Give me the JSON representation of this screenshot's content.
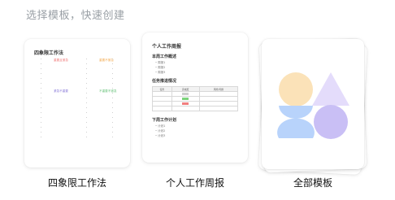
{
  "header": {
    "title": "选择模板，快速创建"
  },
  "cards": [
    {
      "label": "四象限工作法",
      "preview": {
        "title": "四象限工作法",
        "quadrants": [
          {
            "text": "重要且紧急",
            "color": "#f07878"
          },
          {
            "text": "重要不紧急",
            "color": "#f2a94e"
          },
          {
            "text": "紧急不重要",
            "color": "#8a7bd8"
          },
          {
            "text": "不重要不紧急",
            "color": "#67c27a"
          }
        ]
      }
    },
    {
      "label": "个人工作周报",
      "preview": {
        "title": "个人工作周报",
        "section1": "本周工作概述",
        "section1_items": [
          "周报1",
          "周报2",
          "周报3"
        ],
        "section2": "任务推进情况",
        "table_headers": [
          "任务",
          "完成度",
          "风险/问题"
        ],
        "section3": "下周工作计划",
        "section3_items": [
          "计划1",
          "计划2",
          "计划3"
        ]
      }
    },
    {
      "label": "全部模板",
      "preview": {
        "shape_colors": {
          "circle": "#fbe2b8",
          "triangle": "#e4dcfb",
          "bowtie": "#b8d3fb",
          "disc": "#c9bff5"
        }
      }
    }
  ]
}
